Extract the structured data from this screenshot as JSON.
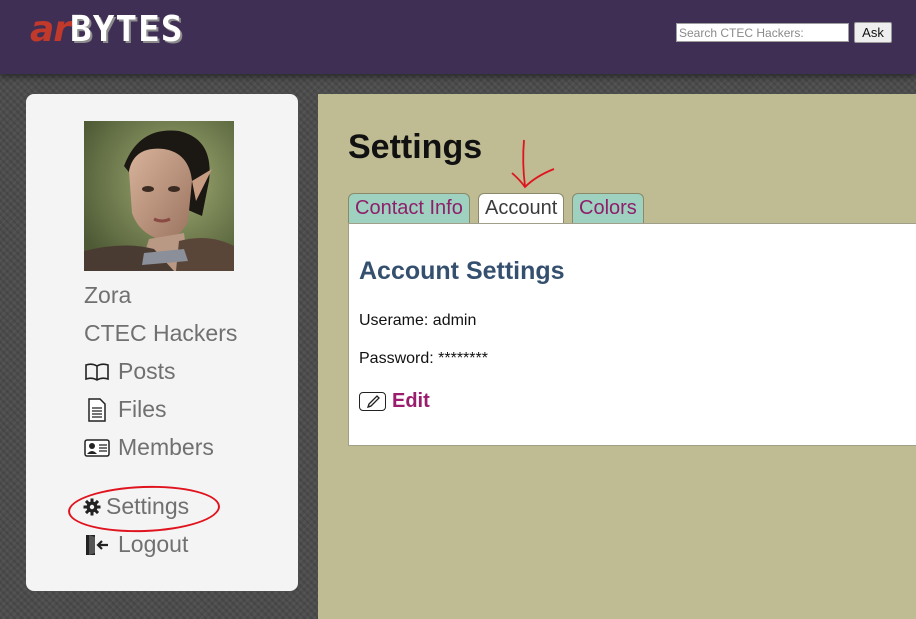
{
  "header": {
    "logo_prefix": "ar",
    "logo_main": "BYTES",
    "search_placeholder": "Search CTEC Hackers:",
    "ask_label": "Ask"
  },
  "sidebar": {
    "user_name": "Zora",
    "group_name": "CTEC Hackers",
    "items": [
      {
        "label": "Posts",
        "icon": "book-icon"
      },
      {
        "label": "Files",
        "icon": "document-icon"
      },
      {
        "label": "Members",
        "icon": "id-card-icon"
      },
      {
        "label": "Settings",
        "icon": "gear-icon"
      },
      {
        "label": "Logout",
        "icon": "logout-icon"
      }
    ]
  },
  "main": {
    "title": "Settings",
    "tabs": [
      {
        "label": "Contact Info",
        "active": false
      },
      {
        "label": "Account",
        "active": true
      },
      {
        "label": "Colors",
        "active": false
      }
    ],
    "panel": {
      "heading": "Account Settings",
      "username_line": "Userame: admin",
      "password_line": "Password: ********",
      "edit_label": "Edit"
    }
  },
  "colors": {
    "header_bg": "#3f2f55",
    "main_bg": "#bfbb93",
    "tab_inactive": "#9ed1c0",
    "link": "#9b1c6d",
    "heading": "#35506f",
    "annotation": "#e0141e"
  }
}
